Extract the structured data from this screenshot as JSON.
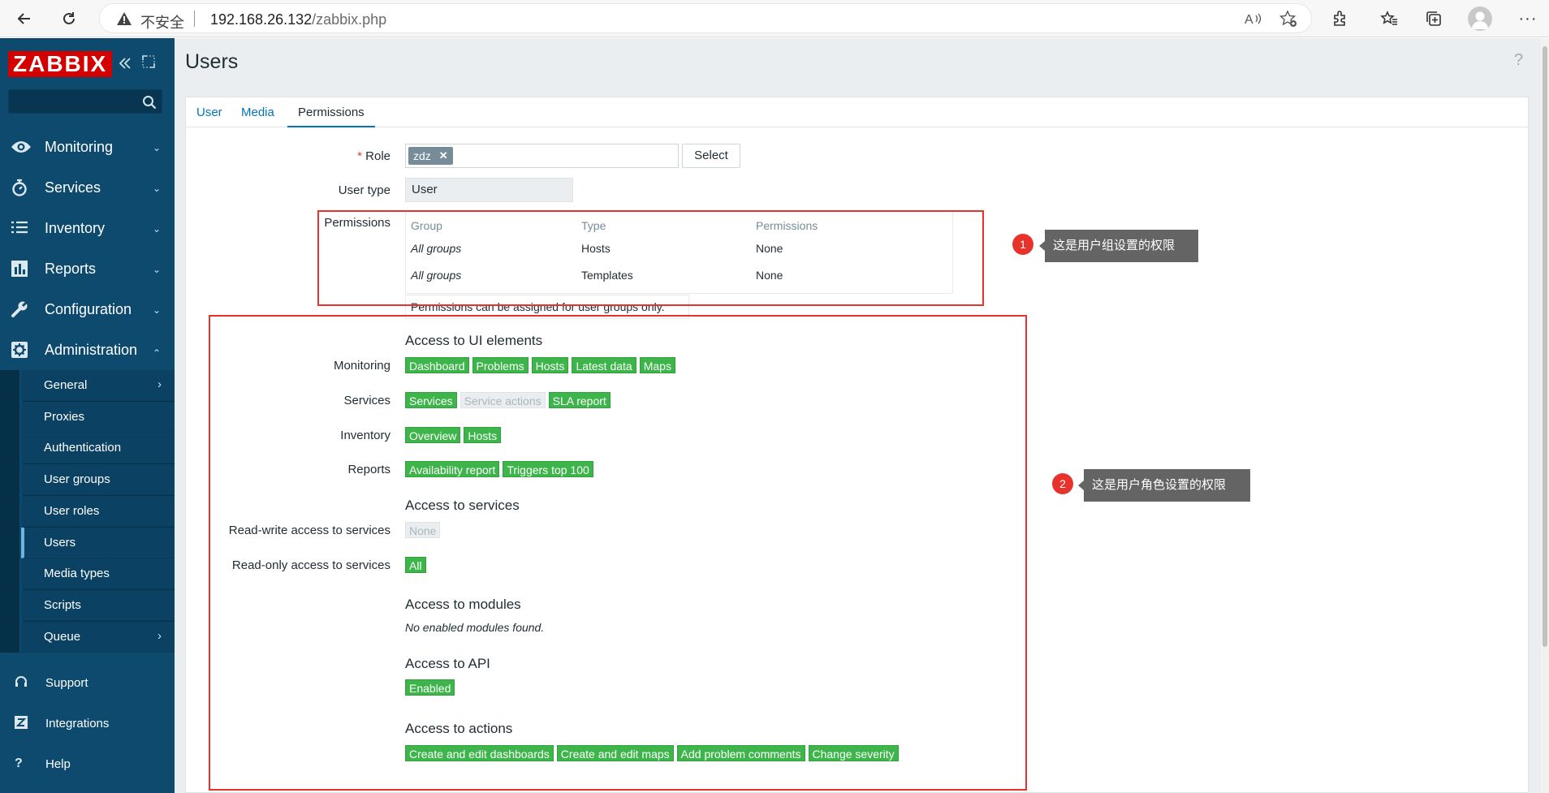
{
  "browser": {
    "insecure_label": "不安全",
    "url_host": "192.168.26.132",
    "url_path": "/zabbix.php"
  },
  "sidebar": {
    "logo": "ZABBIX",
    "menu": [
      {
        "label": "Monitoring",
        "icon": "eye-icon"
      },
      {
        "label": "Services",
        "icon": "stopwatch-icon"
      },
      {
        "label": "Inventory",
        "icon": "list-icon"
      },
      {
        "label": "Reports",
        "icon": "bar-chart-icon"
      },
      {
        "label": "Configuration",
        "icon": "wrench-icon"
      },
      {
        "label": "Administration",
        "icon": "gear-icon"
      }
    ],
    "submenu": [
      {
        "label": "General",
        "arrow": "›"
      },
      {
        "label": "Proxies"
      },
      {
        "label": "Authentication"
      },
      {
        "label": "User groups"
      },
      {
        "label": "User roles"
      },
      {
        "label": "Users"
      },
      {
        "label": "Media types"
      },
      {
        "label": "Scripts"
      },
      {
        "label": "Queue",
        "arrow": "›"
      }
    ],
    "footer": [
      {
        "label": "Support",
        "icon": "headset-icon"
      },
      {
        "label": "Integrations",
        "icon": "z-icon"
      },
      {
        "label": "Help",
        "icon": "question-icon"
      }
    ]
  },
  "page": {
    "title": "Users",
    "help": "?",
    "tabs": [
      "User",
      "Media",
      "Permissions"
    ]
  },
  "form": {
    "role_label": "Role",
    "role_required": "*",
    "role_value": "zdz",
    "select_label": "Select",
    "usertype_label": "User type",
    "usertype_value": "User",
    "permissions_label": "Permissions",
    "perm_headers": [
      "Group",
      "Type",
      "Permissions"
    ],
    "perm_rows": [
      [
        "All groups",
        "Hosts",
        "None"
      ],
      [
        "All groups",
        "Templates",
        "None"
      ]
    ],
    "perm_note": "Permissions can be assigned for user groups only.",
    "ui_title": "Access to UI elements",
    "ui_rows": [
      {
        "label": "Monitoring",
        "tags": [
          {
            "text": "Dashboard",
            "on": true
          },
          {
            "text": "Problems",
            "on": true
          },
          {
            "text": "Hosts",
            "on": true
          },
          {
            "text": "Latest data",
            "on": true
          },
          {
            "text": "Maps",
            "on": true
          }
        ]
      },
      {
        "label": "Services",
        "tags": [
          {
            "text": "Services",
            "on": true
          },
          {
            "text": "Service actions",
            "on": false
          },
          {
            "text": "SLA report",
            "on": true
          }
        ]
      },
      {
        "label": "Inventory",
        "tags": [
          {
            "text": "Overview",
            "on": true
          },
          {
            "text": "Hosts",
            "on": true
          }
        ]
      },
      {
        "label": "Reports",
        "tags": [
          {
            "text": "Availability report",
            "on": true
          },
          {
            "text": "Triggers top 100",
            "on": true
          }
        ]
      }
    ],
    "services_title": "Access to services",
    "rw_label": "Read-write access to services",
    "rw_value": "None",
    "ro_label": "Read-only access to services",
    "ro_value": "All",
    "modules_title": "Access to modules",
    "modules_note": "No enabled modules found.",
    "api_title": "Access to API",
    "api_value": "Enabled",
    "actions_title": "Access to actions",
    "actions_tags": [
      "Create and edit dashboards",
      "Create and edit maps",
      "Add problem comments",
      "Change severity"
    ]
  },
  "annotations": [
    {
      "num": "1",
      "text": "这是用户组设置的权限"
    },
    {
      "num": "2",
      "text": "这是用户角色设置的权限"
    }
  ],
  "colors": {
    "sidebar": "#0e4a6e",
    "submenu": "#062f48",
    "logo": "#d40000",
    "tag_green": "#3db54a",
    "link": "#0275b8",
    "annotation_red": "#e8332d"
  }
}
